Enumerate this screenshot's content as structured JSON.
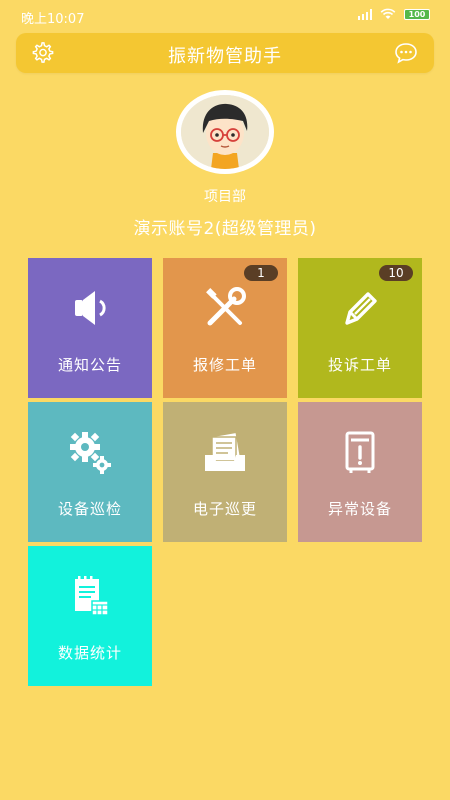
{
  "status_bar": {
    "time": "晚上10:07",
    "battery": "100"
  },
  "header": {
    "title": "振新物管助手"
  },
  "profile": {
    "department": "项目部",
    "account": "演示账号2(超级管理员)"
  },
  "tiles": [
    {
      "label": "通知公告",
      "icon": "speaker-icon",
      "color": "#7b68c1"
    },
    {
      "label": "报修工单",
      "icon": "tools-icon",
      "color": "#e2964c",
      "badge": "1"
    },
    {
      "label": "投诉工单",
      "icon": "pen-icon",
      "color": "#b1b81d",
      "badge": "10"
    },
    {
      "label": "设备巡检",
      "icon": "gears-icon",
      "color": "#5db9c0"
    },
    {
      "label": "电子巡更",
      "icon": "inbox-icon",
      "color": "#c0b075"
    },
    {
      "label": "异常设备",
      "icon": "device-alert-icon",
      "color": "#c69891"
    },
    {
      "label": "数据统计",
      "icon": "notes-icon",
      "color": "#12f2dc"
    }
  ],
  "colors": {
    "background": "#fbd964",
    "header": "#f4c732",
    "badge": "#5a3e25"
  }
}
